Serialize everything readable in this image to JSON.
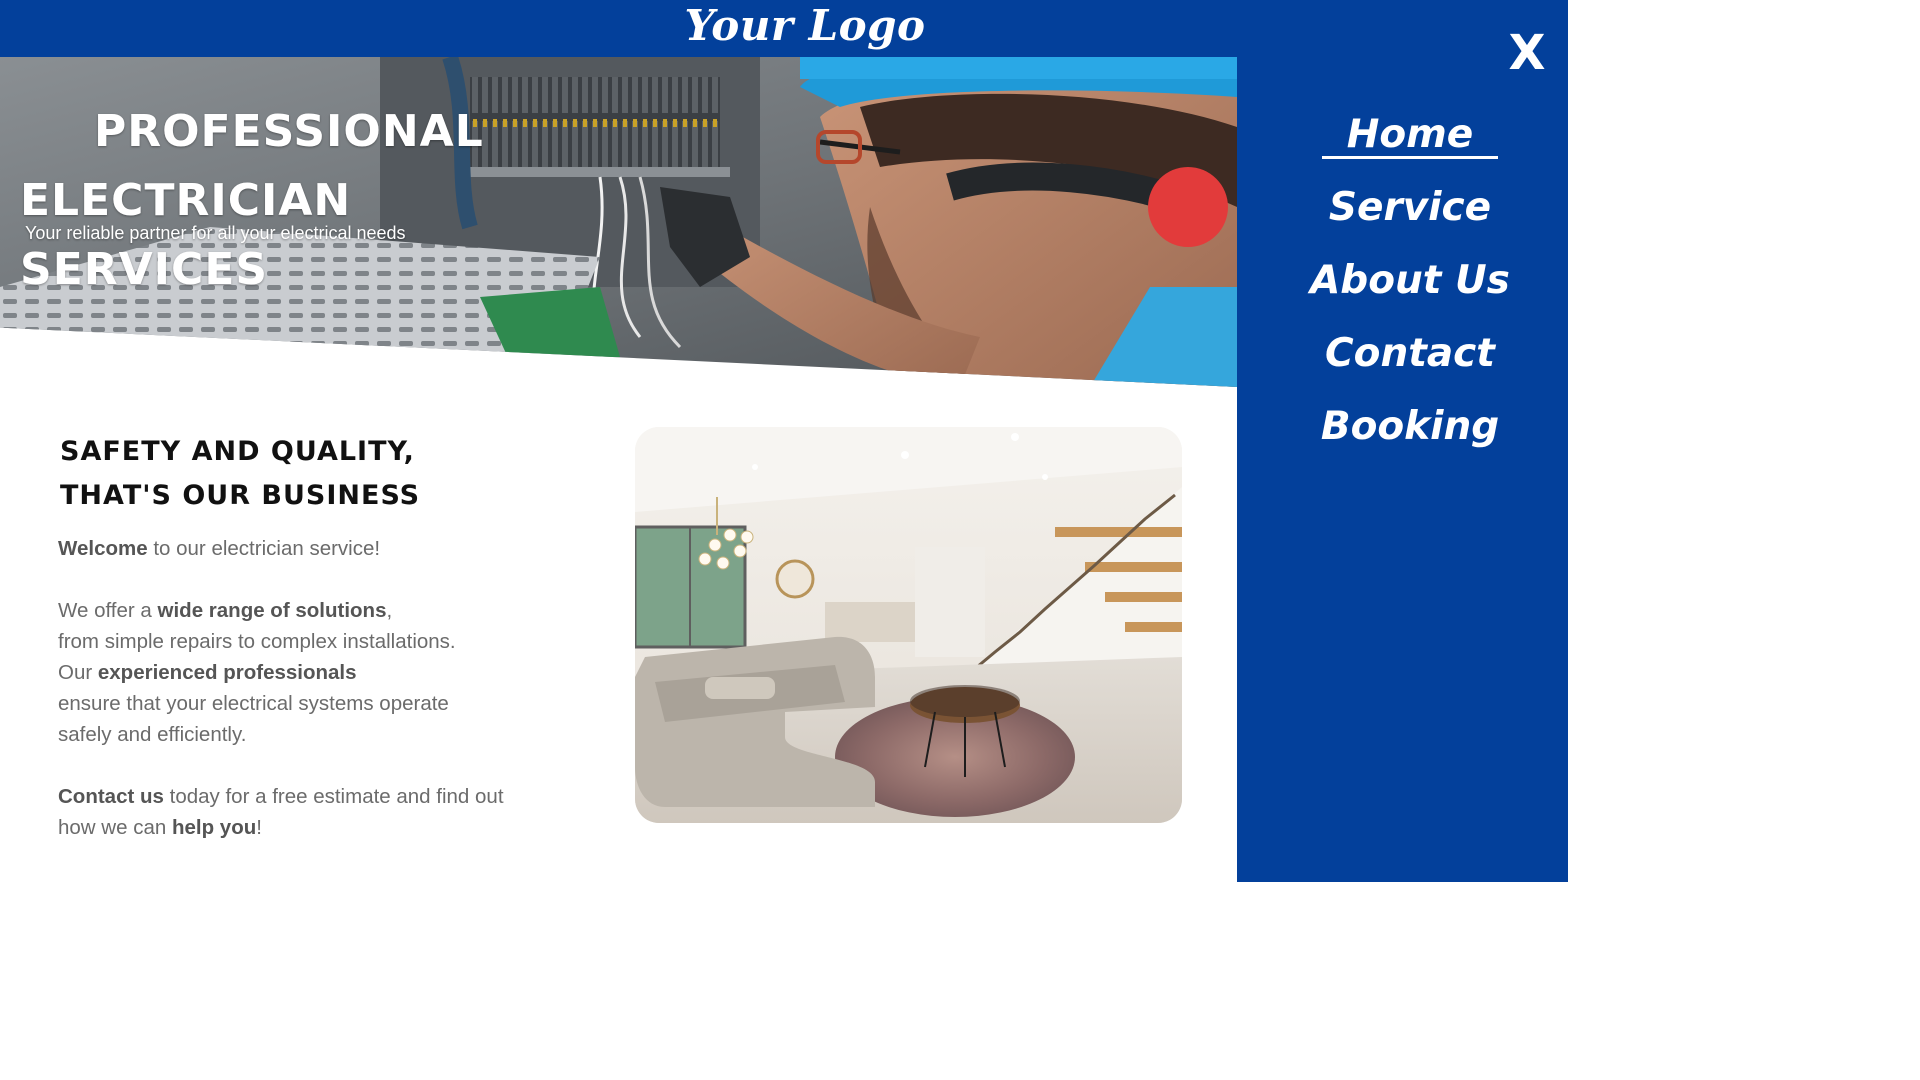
{
  "header": {
    "logo_text": "Your Logo"
  },
  "hero": {
    "title_line1": "Professional",
    "title_line2": "Electrician Services",
    "subtitle": "Your reliable partner for all your electrical needs"
  },
  "content": {
    "title_line1": "Safety and Quality,",
    "title_line2": "That's Our Business",
    "p1": {
      "b1": "Welcome",
      "t1": " to our electrician service!"
    },
    "p2": {
      "t1": "We offer a ",
      "b1": "wide range of solutions",
      "t2": ",",
      "t3": "from simple repairs to complex installations.",
      "t4": "Our ",
      "b2": "experienced professionals",
      "t5": "ensure that your electrical systems operate",
      "t6": "safely and efficiently."
    },
    "p3": {
      "b1": "Contact us",
      "t1": " today for a free estimate and find out",
      "t2": "how we can ",
      "b2": "help you",
      "t3": "!"
    }
  },
  "menu": {
    "close_label": "X",
    "items": [
      {
        "label": "Home",
        "active": true
      },
      {
        "label": "Service"
      },
      {
        "label": "About Us"
      },
      {
        "label": "Contact"
      },
      {
        "label": "Booking"
      }
    ]
  },
  "colors": {
    "brand_blue": "#03409b",
    "menu_text": "#ffffff",
    "body_text": "#6b6b6b"
  }
}
